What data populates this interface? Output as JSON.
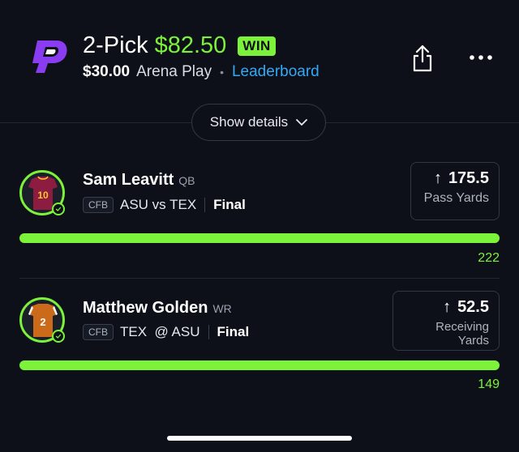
{
  "header": {
    "pick_label": "2-Pick",
    "payout": "$82.50",
    "result_badge": "WIN",
    "entry_amount": "$30.00",
    "play_type": "Arena Play",
    "separator": "•",
    "leaderboard_link": "Leaderboard",
    "share_icon": "share-icon",
    "more_icon": "more-dots-icon"
  },
  "details_toggle": {
    "label": "Show details"
  },
  "colors": {
    "accent": "#7cf23a",
    "link": "#33a9f3",
    "background": "#0d1019",
    "logo": "#8a3cf0"
  },
  "picks": [
    {
      "player": "Sam Leavitt",
      "position": "QB",
      "league": "CFB",
      "matchup": "ASU vs TEX",
      "status": "Final",
      "direction": "↑",
      "line": "175.5",
      "stat": "Pass Yards",
      "result": "222",
      "jersey_number": "10",
      "progress": 1.0
    },
    {
      "player": "Matthew Golden",
      "position": "WR",
      "league": "CFB",
      "matchup": "TEX  @ ASU",
      "status": "Final",
      "direction": "↑",
      "line": "52.5",
      "stat": "Receiving Yards",
      "result": "149",
      "jersey_number": "2",
      "progress": 1.0
    }
  ]
}
